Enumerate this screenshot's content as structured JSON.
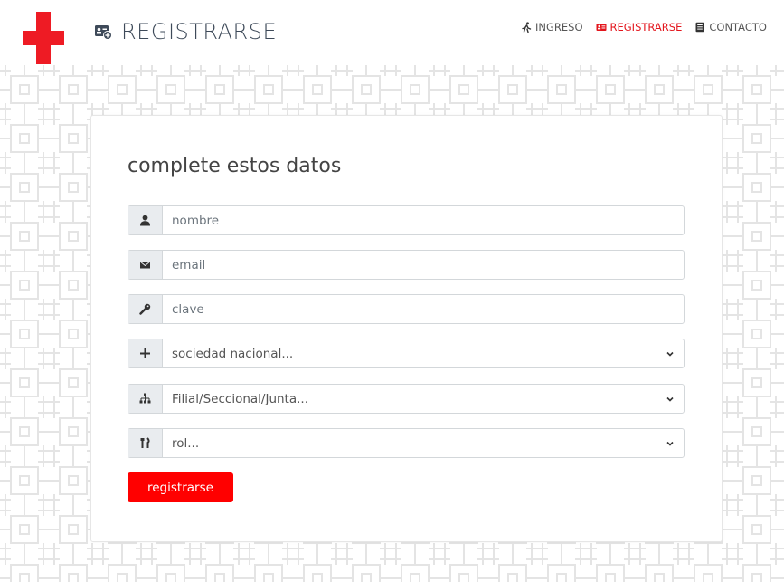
{
  "header": {
    "title": "REGISTRARSE",
    "title_icon": "id-card-plus-icon",
    "brand_color": "#ee1b24"
  },
  "nav": {
    "items": [
      {
        "label": "INGRESO",
        "icon": "running-person-icon",
        "active": false
      },
      {
        "label": "REGISTRARSE",
        "icon": "id-card-icon",
        "active": true
      },
      {
        "label": "CONTACTO",
        "icon": "document-icon",
        "active": false
      }
    ]
  },
  "form": {
    "heading": "complete estos datos",
    "fields": [
      {
        "placeholder": "nombre",
        "icon": "user-icon",
        "type": "input"
      },
      {
        "placeholder": "email",
        "icon": "envelope-icon",
        "type": "input"
      },
      {
        "placeholder": "clave",
        "icon": "key-icon",
        "type": "input"
      },
      {
        "selected": "sociedad nacional...",
        "icon": "plus-icon",
        "type": "select"
      },
      {
        "selected": "Filial/Seccional/Junta...",
        "icon": "sitemap-icon",
        "type": "select"
      },
      {
        "selected": "rol...",
        "icon": "tools-icon",
        "type": "select"
      }
    ],
    "submit_label": "registrarse",
    "accent_color": "#ff0000"
  }
}
